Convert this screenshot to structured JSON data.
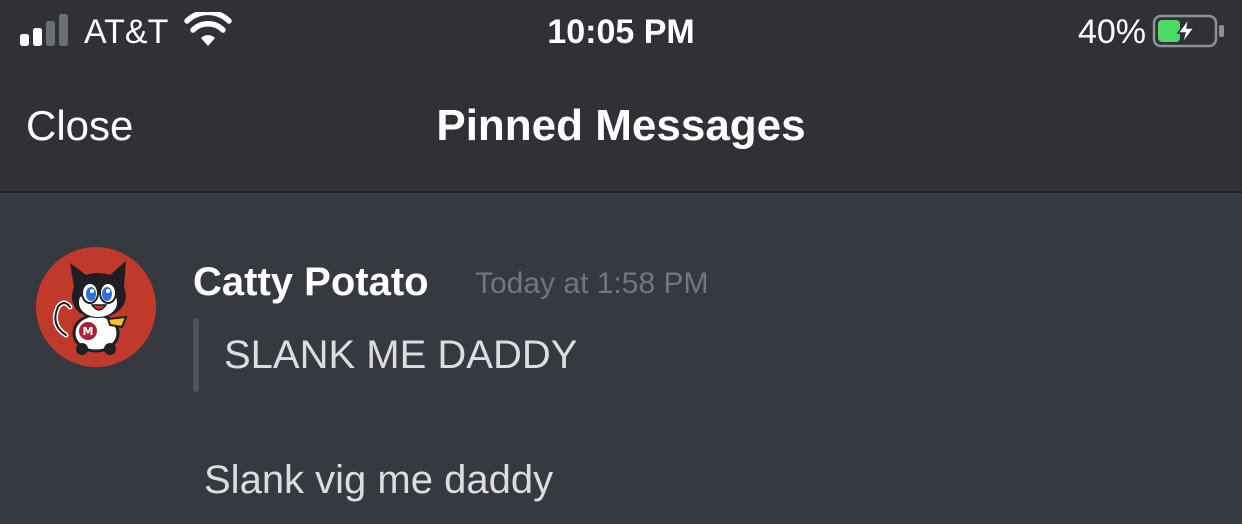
{
  "status_bar": {
    "carrier": "AT&T",
    "time": "10:05 PM",
    "battery_percent": "40%",
    "battery_level": 0.4,
    "battery_color": "#4cd964",
    "signal_bars": 2,
    "signal_bars_total": 4,
    "icons": [
      "signal-icon",
      "wifi-icon",
      "battery-charging-icon"
    ]
  },
  "nav": {
    "close_label": "Close",
    "title": "Pinned Messages"
  },
  "message": {
    "author": "Catty Potato",
    "timestamp": "Today at 1:58 PM",
    "quote": "SLANK ME DADDY",
    "text": "Slank vig me daddy",
    "avatar_icon": "cat-avatar-icon",
    "avatar_bg": "#c0392b"
  },
  "colors": {
    "background": "#36393f",
    "header": "#2f3136",
    "text": "#dcddde",
    "muted": "#72767d"
  }
}
